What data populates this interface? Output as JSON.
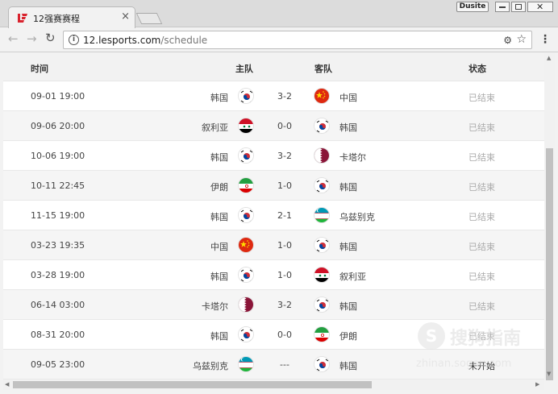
{
  "browser": {
    "tab_title": "12强赛赛程",
    "tab_close": "×",
    "user_badge": "Dusite",
    "url_host": "12.lesports.com",
    "url_path": "/schedule",
    "icons": [
      "logo-icon",
      "back-icon",
      "forward-icon",
      "reload-icon",
      "info-icon",
      "extension-icon",
      "star-icon",
      "menu-icon"
    ]
  },
  "table": {
    "headers": {
      "time": "时间",
      "home": "主队",
      "away": "客队",
      "status": "状态"
    },
    "rows": [
      {
        "time": "09-01 19:00",
        "home": "韩国",
        "home_flag": "kr",
        "score": "3-2",
        "away": "中国",
        "away_flag": "cn",
        "status": "已结束"
      },
      {
        "time": "09-06 20:00",
        "home": "叙利亚",
        "home_flag": "sy",
        "score": "0-0",
        "away": "韩国",
        "away_flag": "kr",
        "status": "已结束"
      },
      {
        "time": "10-06 19:00",
        "home": "韩国",
        "home_flag": "kr",
        "score": "3-2",
        "away": "卡塔尔",
        "away_flag": "qa",
        "status": "已结束"
      },
      {
        "time": "10-11 22:45",
        "home": "伊朗",
        "home_flag": "ir",
        "score": "1-0",
        "away": "韩国",
        "away_flag": "kr",
        "status": "已结束"
      },
      {
        "time": "11-15 19:00",
        "home": "韩国",
        "home_flag": "kr",
        "score": "2-1",
        "away": "乌兹别克",
        "away_flag": "uz",
        "status": "已结束"
      },
      {
        "time": "03-23 19:35",
        "home": "中国",
        "home_flag": "cn",
        "score": "1-0",
        "away": "韩国",
        "away_flag": "kr",
        "status": "已结束"
      },
      {
        "time": "03-28 19:00",
        "home": "韩国",
        "home_flag": "kr",
        "score": "1-0",
        "away": "叙利亚",
        "away_flag": "sy",
        "status": "已结束"
      },
      {
        "time": "06-14 03:00",
        "home": "卡塔尔",
        "home_flag": "qa",
        "score": "3-2",
        "away": "韩国",
        "away_flag": "kr",
        "status": "已结束"
      },
      {
        "time": "08-31 20:00",
        "home": "韩国",
        "home_flag": "kr",
        "score": "0-0",
        "away": "伊朗",
        "away_flag": "ir",
        "status": "已结束"
      },
      {
        "time": "09-05 23:00",
        "home": "乌兹别克",
        "home_flag": "uz",
        "score": "---",
        "away": "韩国",
        "away_flag": "kr",
        "status": "未开始"
      }
    ]
  },
  "watermark": {
    "logo": "S",
    "text": "搜狗指南",
    "sub": "zhinan.sogou.com"
  },
  "colors": {
    "status_done": "#aaaaaa",
    "status_upcoming": "#333333",
    "row_alt": "#f5f5f5",
    "brand_red": "#d9232e"
  }
}
